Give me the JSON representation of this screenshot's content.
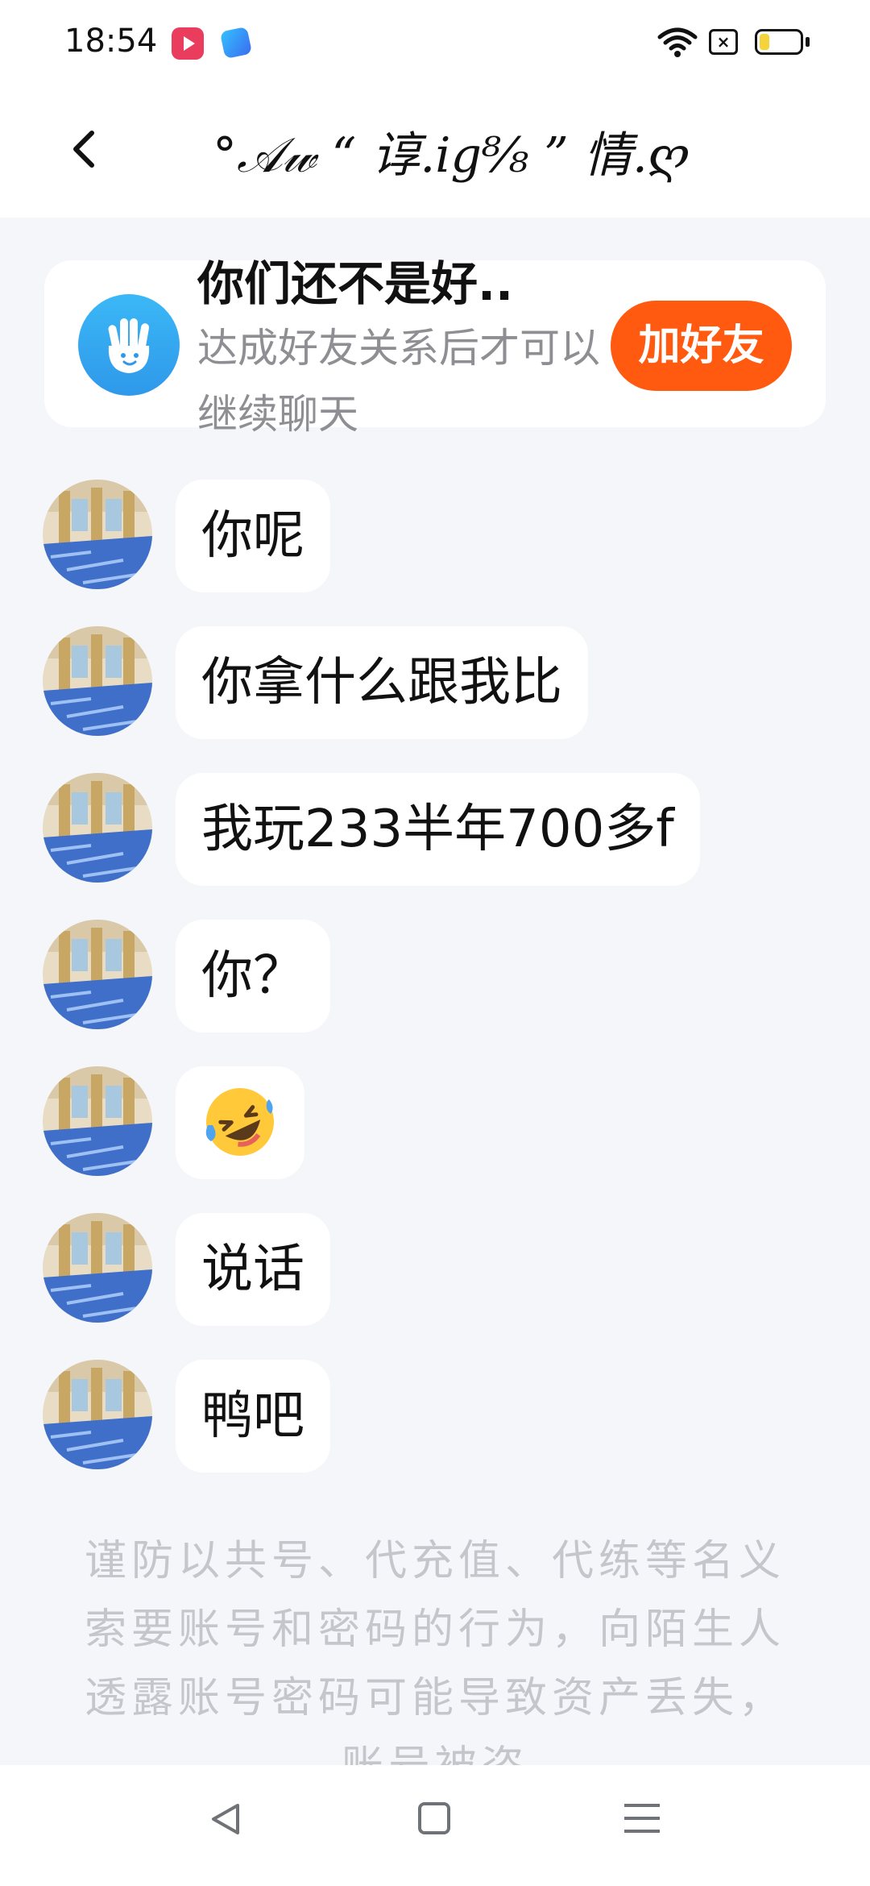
{
  "status_bar": {
    "time": "18:54",
    "icons": [
      "video-app-icon",
      "blue-app-icon",
      "wifi-icon",
      "no-sim-icon",
      "battery-icon"
    ],
    "battery_level": 0.25
  },
  "header": {
    "title": "°𝒜𝓌 “ 谆.ig⁸⁄₈ ” 情.ღ"
  },
  "friend_card": {
    "title": "你们还不是好..",
    "subtitle": "达成好友关系后才可以继续聊天",
    "button_label": "加好友",
    "icon": "hand-wave-icon"
  },
  "messages": [
    {
      "text": "你呢"
    },
    {
      "text": "你拿什么跟我比"
    },
    {
      "text": "我玩233半年700多f"
    },
    {
      "text": "你？"
    },
    {
      "text": "",
      "emoji": "rolling-on-floor-laughing"
    },
    {
      "text": "说话"
    },
    {
      "text": "鸭吧"
    }
  ],
  "warning_text": "谨防以共号、代充值、代练等名义索要账号和密码的行为，向陌生人透露账号密码可能导致资产丢失，账号被盗",
  "nav_bar": {
    "icons": [
      "back-triangle-icon",
      "home-square-icon",
      "menu-lines-icon"
    ]
  },
  "colors": {
    "accent": "#ff5a10",
    "background": "#f4f6f9",
    "card": "#ffffff",
    "hand_icon": "#2f98ea"
  }
}
